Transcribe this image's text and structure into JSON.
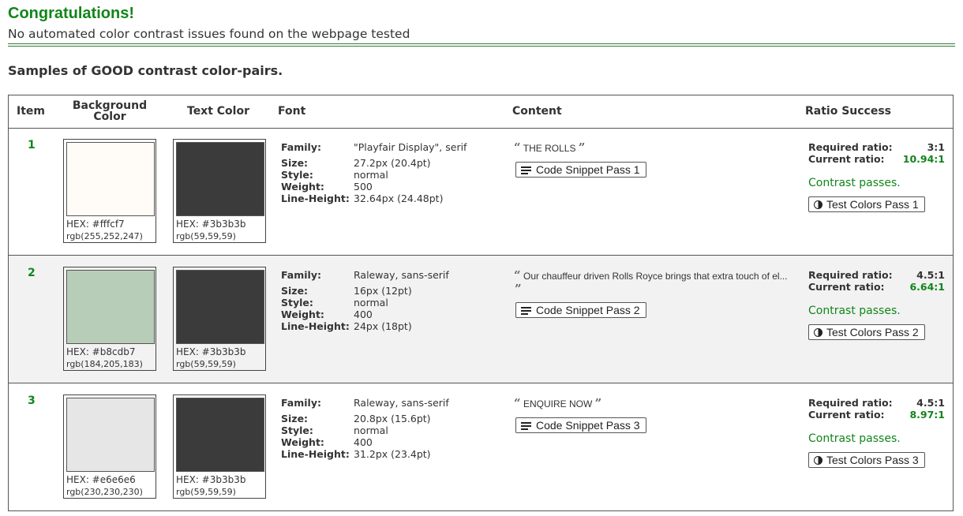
{
  "header": {
    "title": "Congratulations!",
    "subtitle": "No automated color contrast issues found on the webpage tested"
  },
  "section_title": "Samples of GOOD contrast color-pairs.",
  "table": {
    "columns": {
      "item": "Item",
      "background": "Background Color",
      "text_color": "Text Color",
      "font": "Font",
      "content": "Content",
      "ratio": "Ratio Success"
    },
    "labels": {
      "family": "Family:",
      "size": "Size:",
      "style": "Style:",
      "weight": "Weight:",
      "line_height": "Line-Height:",
      "required": "Required ratio:",
      "current": "Current ratio:"
    },
    "rows": [
      {
        "num": "1",
        "bg_color": "#fffcf7",
        "bg_hex": "HEX: #fffcf7",
        "bg_rgb": "rgb(255,252,247)",
        "fg_color": "#3b3b3b",
        "fg_hex": "HEX: #3b3b3b",
        "fg_rgb": "rgb(59,59,59)",
        "family": "\"Playfair Display\", serif",
        "size": "27.2px (20.4pt)",
        "style": "normal",
        "weight": "500",
        "line_height": "32.64px (24.48pt)",
        "content": "THE ROLLS",
        "snippet_label": "Code Snippet Pass 1",
        "required": "3:1",
        "current": "10.94:1",
        "pass_msg": "Contrast passes.",
        "test_label": "Test Colors Pass 1"
      },
      {
        "num": "2",
        "bg_color": "#b8cdb7",
        "bg_hex": "HEX: #b8cdb7",
        "bg_rgb": "rgb(184,205,183)",
        "fg_color": "#3b3b3b",
        "fg_hex": "HEX: #3b3b3b",
        "fg_rgb": "rgb(59,59,59)",
        "family": "Raleway, sans-serif",
        "size": "16px (12pt)",
        "style": "normal",
        "weight": "400",
        "line_height": "24px (18pt)",
        "content": "Our chauffeur driven Rolls Royce brings that extra touch of el...",
        "snippet_label": "Code Snippet Pass 2",
        "required": "4.5:1",
        "current": "6.64:1",
        "pass_msg": "Contrast passes.",
        "test_label": "Test Colors Pass 2"
      },
      {
        "num": "3",
        "bg_color": "#e6e6e6",
        "bg_hex": "HEX: #e6e6e6",
        "bg_rgb": "rgb(230,230,230)",
        "fg_color": "#3b3b3b",
        "fg_hex": "HEX: #3b3b3b",
        "fg_rgb": "rgb(59,59,59)",
        "family": "Raleway, sans-serif",
        "size": "20.8px (15.6pt)",
        "style": "normal",
        "weight": "400",
        "line_height": "31.2px (23.4pt)",
        "content": "ENQUIRE NOW",
        "snippet_label": "Code Snippet Pass 3",
        "required": "4.5:1",
        "current": "8.97:1",
        "pass_msg": "Contrast passes.",
        "test_label": "Test Colors Pass 3"
      }
    ]
  },
  "icons": {
    "quote_open": "“",
    "quote_close": "”",
    "snippet_icon": "lines-icon",
    "test_icon": "contrast-icon"
  },
  "colors": {
    "accent_green": "#12851a"
  }
}
